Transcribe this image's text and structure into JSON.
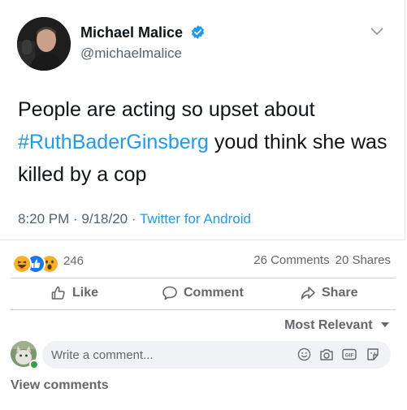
{
  "tweet": {
    "author_name": "Michael Malice",
    "author_handle": "@michaelmalice",
    "text_before": "People are acting so upset about ",
    "hashtag": "#RuthBaderGinsberg",
    "text_after": " youd think she was killed by a cop",
    "time": "8:20 PM",
    "date": "9/18/20",
    "source": "Twitter for Android",
    "sep1": " · ",
    "sep2": " · ",
    "link_color": "#1d9bf0"
  },
  "facebook": {
    "reactions": [
      "haha-icon",
      "like-icon",
      "wow-icon"
    ],
    "reaction_count": "246",
    "comments_count": "26 Comments",
    "shares_count": "20 Shares",
    "actions": {
      "like": "Like",
      "comment": "Comment",
      "share": "Share"
    },
    "sort_label": "Most Relevant",
    "comment_placeholder": "Write a comment...",
    "view_comments": "View comments"
  }
}
